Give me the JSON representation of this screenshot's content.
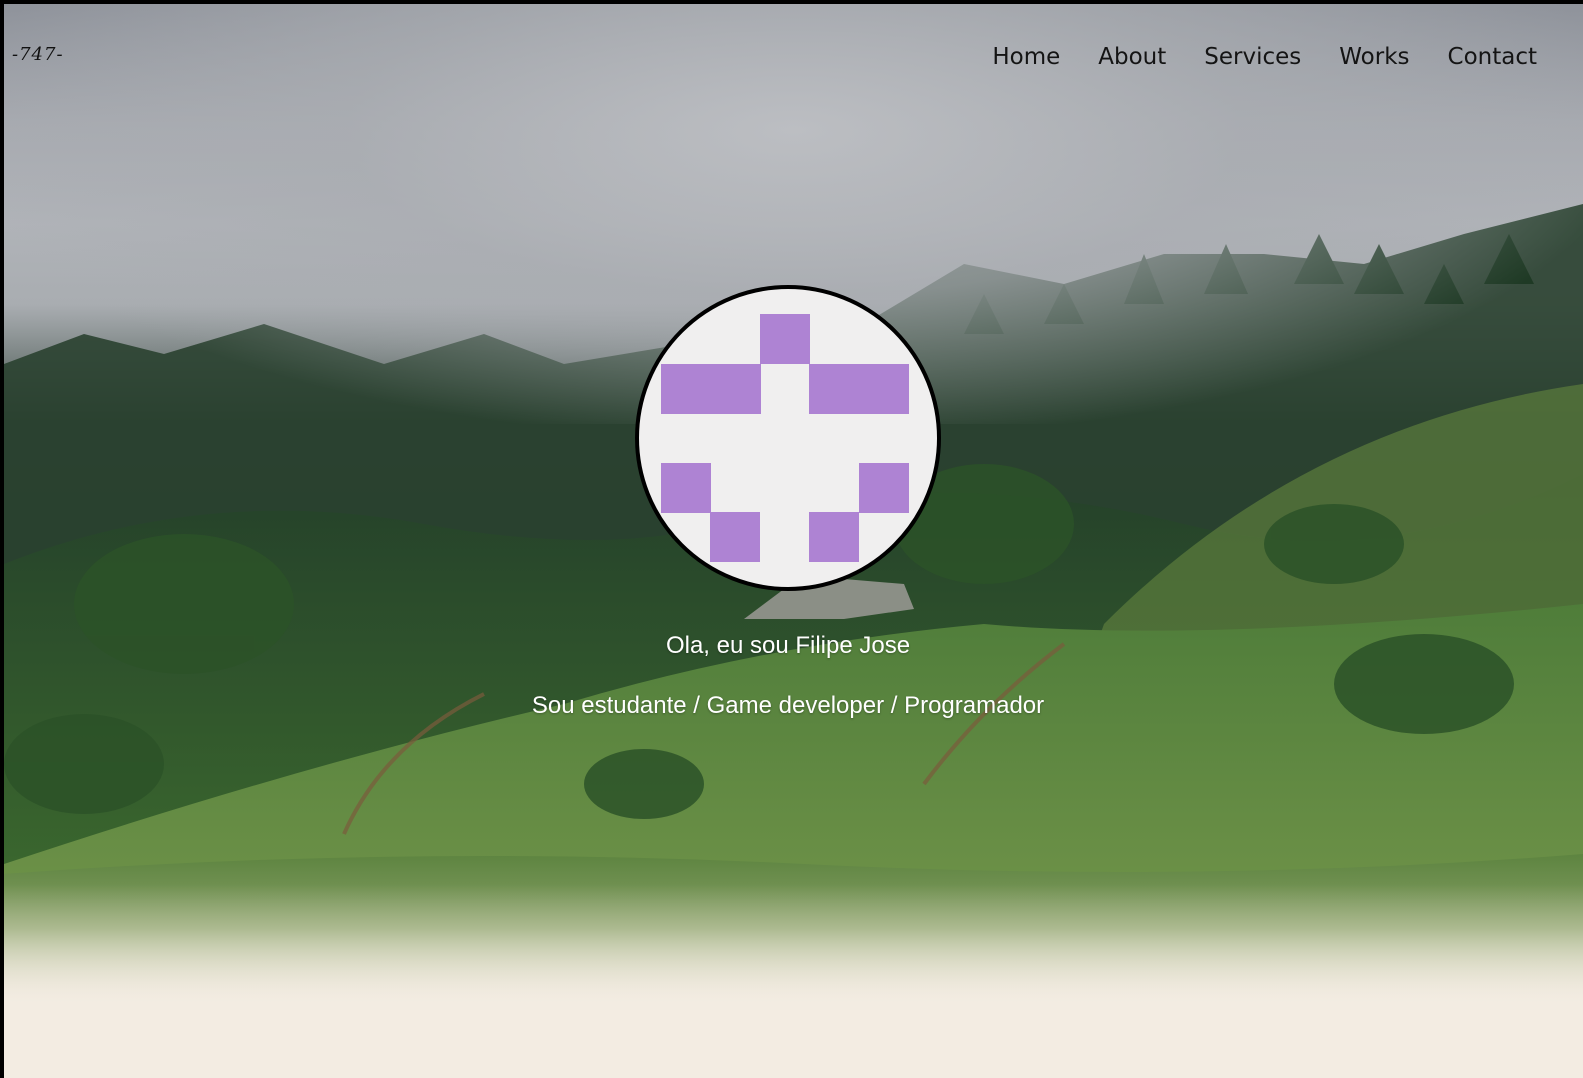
{
  "header": {
    "logo": "-747-",
    "nav": [
      {
        "label": "Home"
      },
      {
        "label": "About"
      },
      {
        "label": "Services"
      },
      {
        "label": "Works"
      },
      {
        "label": "Contact"
      }
    ]
  },
  "hero": {
    "greeting": "Ola, eu sou Filipe Jose",
    "tagline": "Sou estudante / Game developer / Programador"
  },
  "colors": {
    "avatar_pixel": "#ae83d3",
    "avatar_bg": "#f0efef",
    "page_bg": "#f3ece2"
  }
}
